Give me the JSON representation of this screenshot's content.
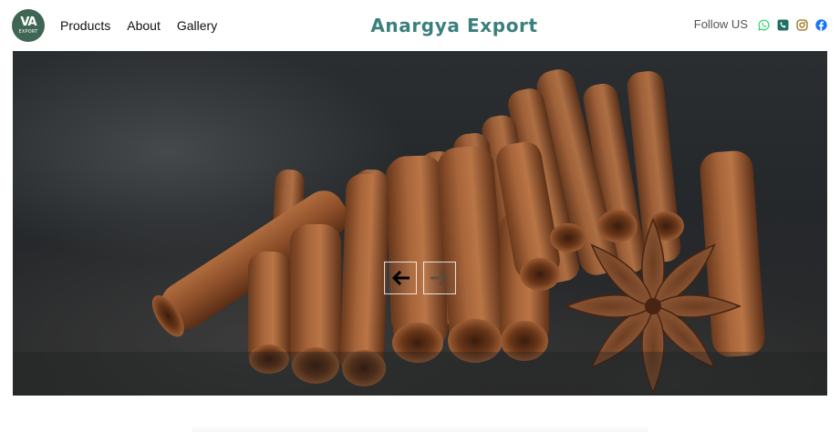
{
  "header": {
    "logo": {
      "mark": "VA",
      "word": "EXPORT"
    },
    "nav": [
      "Products",
      "About",
      "Gallery"
    ],
    "brand_name": "Anargya Export",
    "follow_label": "Follow US",
    "social_icons": [
      "whatsapp-icon",
      "phone-icon",
      "instagram-icon",
      "facebook-icon"
    ]
  },
  "hero": {
    "image_subject": "cinnamon sticks and star anise",
    "controls": {
      "prev_icon": "arrow-left-icon",
      "next_icon": "arrow-right-icon"
    }
  },
  "colors": {
    "brand_teal": "#3b7f7d",
    "logo_green": "#3f6654",
    "whatsapp": "#25d366",
    "phone": "#1f6f64",
    "instagram": "#a07a2c",
    "facebook": "#1877f2"
  }
}
